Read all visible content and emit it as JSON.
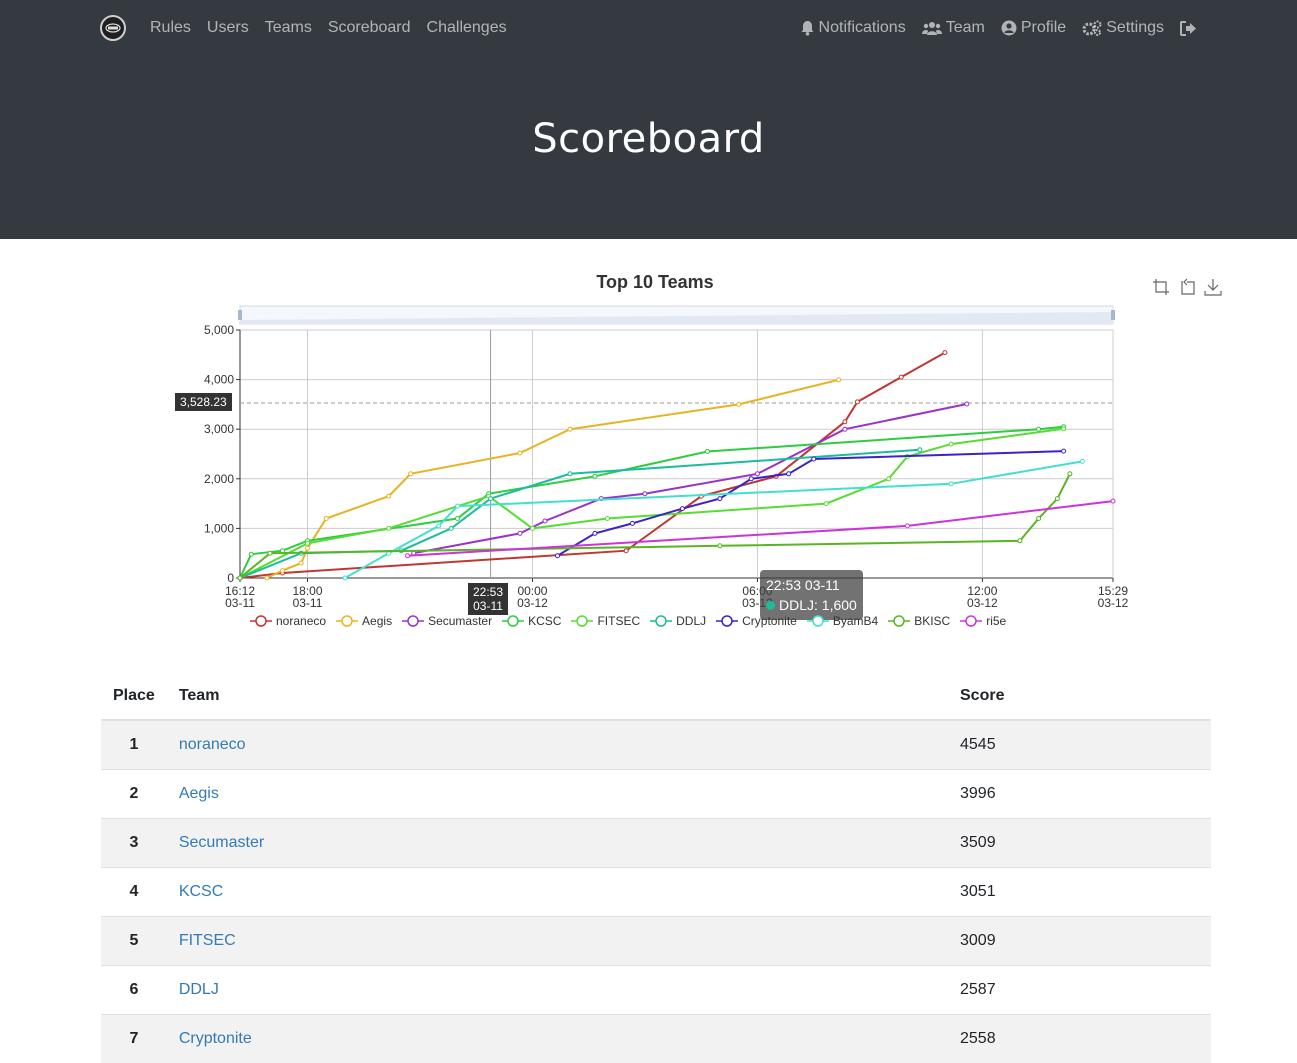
{
  "nav": {
    "brand_icon": "ctf-logo",
    "left": [
      "Rules",
      "Users",
      "Teams",
      "Scoreboard",
      "Challenges"
    ],
    "right": [
      {
        "label": "Notifications",
        "icon": "bell-icon"
      },
      {
        "label": "Team",
        "icon": "users-icon"
      },
      {
        "label": "Profile",
        "icon": "user-circle-icon"
      },
      {
        "label": "Settings",
        "icon": "gears-icon"
      },
      {
        "label": "",
        "icon": "logout-icon"
      }
    ]
  },
  "page": {
    "title": "Scoreboard"
  },
  "chart_data": {
    "type": "line",
    "title": "Top 10 Teams",
    "xlabel": "",
    "ylabel": "",
    "ylim": [
      0,
      5000
    ],
    "yticks": [
      "0",
      "1,000",
      "2,000",
      "3,000",
      "4,000",
      "5,000"
    ],
    "xticks": [
      {
        "time": "16:12",
        "date": "03-11"
      },
      {
        "time": "18:00",
        "date": "03-11"
      },
      {
        "time": "00:00",
        "date": "03-12"
      },
      {
        "time": "06:00",
        "date": "03-12"
      },
      {
        "time": "12:00",
        "date": "03-12"
      },
      {
        "time": "15:29",
        "date": "03-12"
      }
    ],
    "grid": true,
    "legend_position": "bottom",
    "cursor_y_label": "3,528.23",
    "cursor_x_label": {
      "time": "22:53",
      "date": "03-11"
    },
    "tooltip": {
      "title": "22:53 03-11",
      "series": "DDLJ",
      "value": "1,600"
    },
    "series": [
      {
        "name": "noraneco",
        "color": "#c23531",
        "points": [
          [
            "03-11 16:12",
            0
          ],
          [
            "03-11 17:20",
            100
          ],
          [
            "03-12 02:30",
            550
          ],
          [
            "03-12 04:30",
            1650
          ],
          [
            "03-12 06:30",
            2050
          ],
          [
            "03-12 08:20",
            3150
          ],
          [
            "03-12 08:40",
            3550
          ],
          [
            "03-12 09:50",
            4050
          ],
          [
            "03-12 11:00",
            4545
          ]
        ]
      },
      {
        "name": "Aegis",
        "color": "#e6b422",
        "points": [
          [
            "03-11 16:55",
            0
          ],
          [
            "03-11 17:20",
            150
          ],
          [
            "03-11 17:50",
            300
          ],
          [
            "03-11 18:00",
            600
          ],
          [
            "03-11 18:30",
            1200
          ],
          [
            "03-11 20:10",
            1650
          ],
          [
            "03-11 20:45",
            2100
          ],
          [
            "03-11 23:40",
            2520
          ],
          [
            "03-12 01:00",
            3000
          ],
          [
            "03-12 05:30",
            3500
          ],
          [
            "03-12 08:10",
            3996
          ]
        ]
      },
      {
        "name": "Secumaster",
        "color": "#9932cc",
        "points": [
          [
            "03-11 20:50",
            500
          ],
          [
            "03-11 23:40",
            900
          ],
          [
            "03-12 00:20",
            1150
          ],
          [
            "03-12 01:50",
            1600
          ],
          [
            "03-12 03:00",
            1700
          ],
          [
            "03-12 06:00",
            2100
          ],
          [
            "03-12 08:20",
            3000
          ],
          [
            "03-12 11:35",
            3509
          ]
        ]
      },
      {
        "name": "KCSC",
        "color": "#2ecc40",
        "points": [
          [
            "03-11 16:12",
            0
          ],
          [
            "03-11 16:30",
            480
          ],
          [
            "03-11 17:20",
            550
          ],
          [
            "03-11 18:00",
            750
          ],
          [
            "03-11 22:00",
            1200
          ],
          [
            "03-11 22:50",
            1700
          ],
          [
            "03-12 01:40",
            2050
          ],
          [
            "03-12 04:40",
            2550
          ],
          [
            "03-12 13:30",
            3000
          ],
          [
            "03-12 14:10",
            3051
          ]
        ]
      },
      {
        "name": "FITSEC",
        "color": "#55dd33",
        "points": [
          [
            "03-11 16:12",
            0
          ],
          [
            "03-11 18:00",
            700
          ],
          [
            "03-11 20:10",
            1000
          ],
          [
            "03-11 22:50",
            1650
          ],
          [
            "03-12 00:00",
            1000
          ],
          [
            "03-12 02:00",
            1200
          ],
          [
            "03-12 07:50",
            1500
          ],
          [
            "03-12 09:30",
            2000
          ],
          [
            "03-12 10:00",
            2450
          ],
          [
            "03-12 11:10",
            2700
          ],
          [
            "03-12 14:10",
            3009
          ]
        ]
      },
      {
        "name": "DDLJ",
        "color": "#1abc9c",
        "points": [
          [
            "03-11 16:12",
            0
          ],
          [
            "03-11 17:50",
            500
          ],
          [
            "03-11 20:30",
            550
          ],
          [
            "03-11 21:50",
            1000
          ],
          [
            "03-11 22:53",
            1600
          ],
          [
            "03-12 01:00",
            2100
          ],
          [
            "03-12 10:20",
            2587
          ]
        ]
      },
      {
        "name": "Cryptonite",
        "color": "#3a22cc",
        "points": [
          [
            "03-12 00:40",
            450
          ],
          [
            "03-12 01:40",
            900
          ],
          [
            "03-12 02:40",
            1100
          ],
          [
            "03-12 04:00",
            1400
          ],
          [
            "03-12 05:00",
            1600
          ],
          [
            "03-12 05:50",
            2000
          ],
          [
            "03-12 06:50",
            2100
          ],
          [
            "03-12 07:30",
            2400
          ],
          [
            "03-12 14:10",
            2558
          ]
        ]
      },
      {
        "name": "ByamB4",
        "color": "#40e0d0",
        "points": [
          [
            "03-11 19:00",
            0
          ],
          [
            "03-11 20:10",
            500
          ],
          [
            "03-11 21:30",
            1050
          ],
          [
            "03-11 22:00",
            1450
          ],
          [
            "03-12 11:10",
            1900
          ],
          [
            "03-12 14:40",
            2350
          ]
        ]
      },
      {
        "name": "BKISC",
        "color": "#59b522",
        "points": [
          [
            "03-11 16:12",
            0
          ],
          [
            "03-11 17:00",
            500
          ],
          [
            "03-12 05:00",
            650
          ],
          [
            "03-12 13:00",
            750
          ],
          [
            "03-12 13:30",
            1200
          ],
          [
            "03-12 14:00",
            1600
          ],
          [
            "03-12 14:20",
            2100
          ]
        ]
      },
      {
        "name": "ri5e",
        "color": "#cc33dd",
        "points": [
          [
            "03-11 20:40",
            450
          ],
          [
            "03-12 10:00",
            1050
          ],
          [
            "03-12 15:29",
            1550
          ]
        ]
      }
    ]
  },
  "toolbox": [
    "zoom-icon",
    "zoom-reset-icon",
    "download-icon"
  ],
  "table": {
    "headers": {
      "place": "Place",
      "team": "Team",
      "score": "Score"
    },
    "rows": [
      {
        "place": "1",
        "team": "noraneco",
        "score": "4545"
      },
      {
        "place": "2",
        "team": "Aegis",
        "score": "3996"
      },
      {
        "place": "3",
        "team": "Secumaster",
        "score": "3509"
      },
      {
        "place": "4",
        "team": "KCSC",
        "score": "3051"
      },
      {
        "place": "5",
        "team": "FITSEC",
        "score": "3009"
      },
      {
        "place": "6",
        "team": "DDLJ",
        "score": "2587"
      },
      {
        "place": "7",
        "team": "Cryptonite",
        "score": "2558"
      }
    ]
  }
}
